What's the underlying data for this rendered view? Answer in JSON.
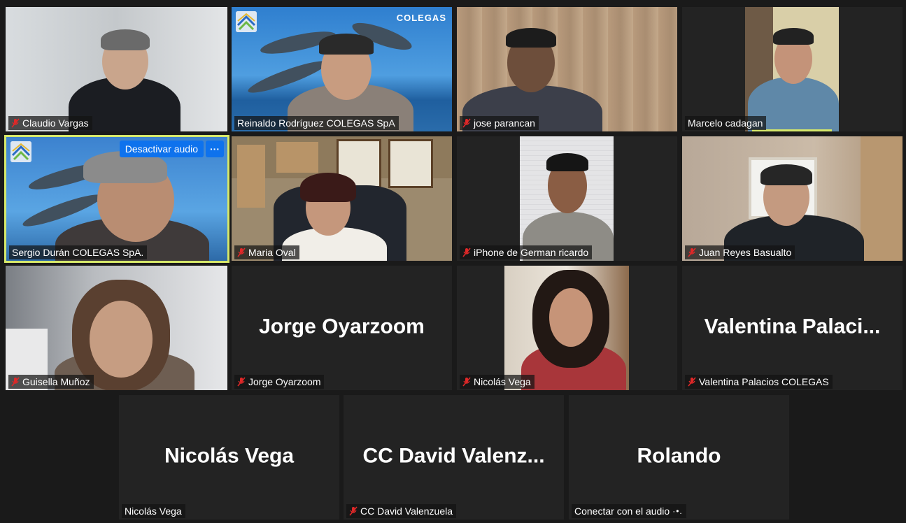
{
  "participants": [
    {
      "name": "Claudio Vargas",
      "muted": true
    },
    {
      "name": "Reinaldo Rodríguez  COLEGAS SpA",
      "muted": false
    },
    {
      "name": "jose parancan",
      "muted": true
    },
    {
      "name": "Marcelo cadagan",
      "muted": false
    },
    {
      "name": "Sergio Durán COLEGAS SpA.",
      "muted": false
    },
    {
      "name": "Maria Oval",
      "muted": true
    },
    {
      "name": "iPhone de German ricardo",
      "muted": true
    },
    {
      "name": "Juan Reyes Basualto",
      "muted": true
    },
    {
      "name": "Guisella Muñoz",
      "muted": true
    },
    {
      "name": "Jorge Oyarzoom",
      "muted": true,
      "display": "Jorge Oyarzoom"
    },
    {
      "name": "Nicolás Vega",
      "muted": true
    },
    {
      "name": "Valentina Palacios COLEGAS",
      "muted": true,
      "display": "Valentina  Palaci..."
    },
    {
      "name": "Nicolás Vega",
      "muted": false,
      "display": "Nicolás Vega"
    },
    {
      "name": "CC David Valenzuela",
      "muted": true,
      "display": "CC  David  Valenz..."
    },
    {
      "name": "Conectar con el audio",
      "muted": false,
      "display": "Rolando",
      "connecting_dots": "·•."
    }
  ],
  "controls": {
    "audio_button": "Desactivar audio",
    "more_button": "···"
  },
  "branding": {
    "colegas_text": "COLEGAS"
  },
  "colors": {
    "active_speaker_border": "#d6e86a",
    "button_blue": "#0e72ed",
    "mute_red": "#e02828",
    "tile_bg": "#232323",
    "page_bg": "#1a1a1a"
  },
  "icons": {
    "muted": "mic-muted-icon",
    "more": "more-options-icon"
  }
}
